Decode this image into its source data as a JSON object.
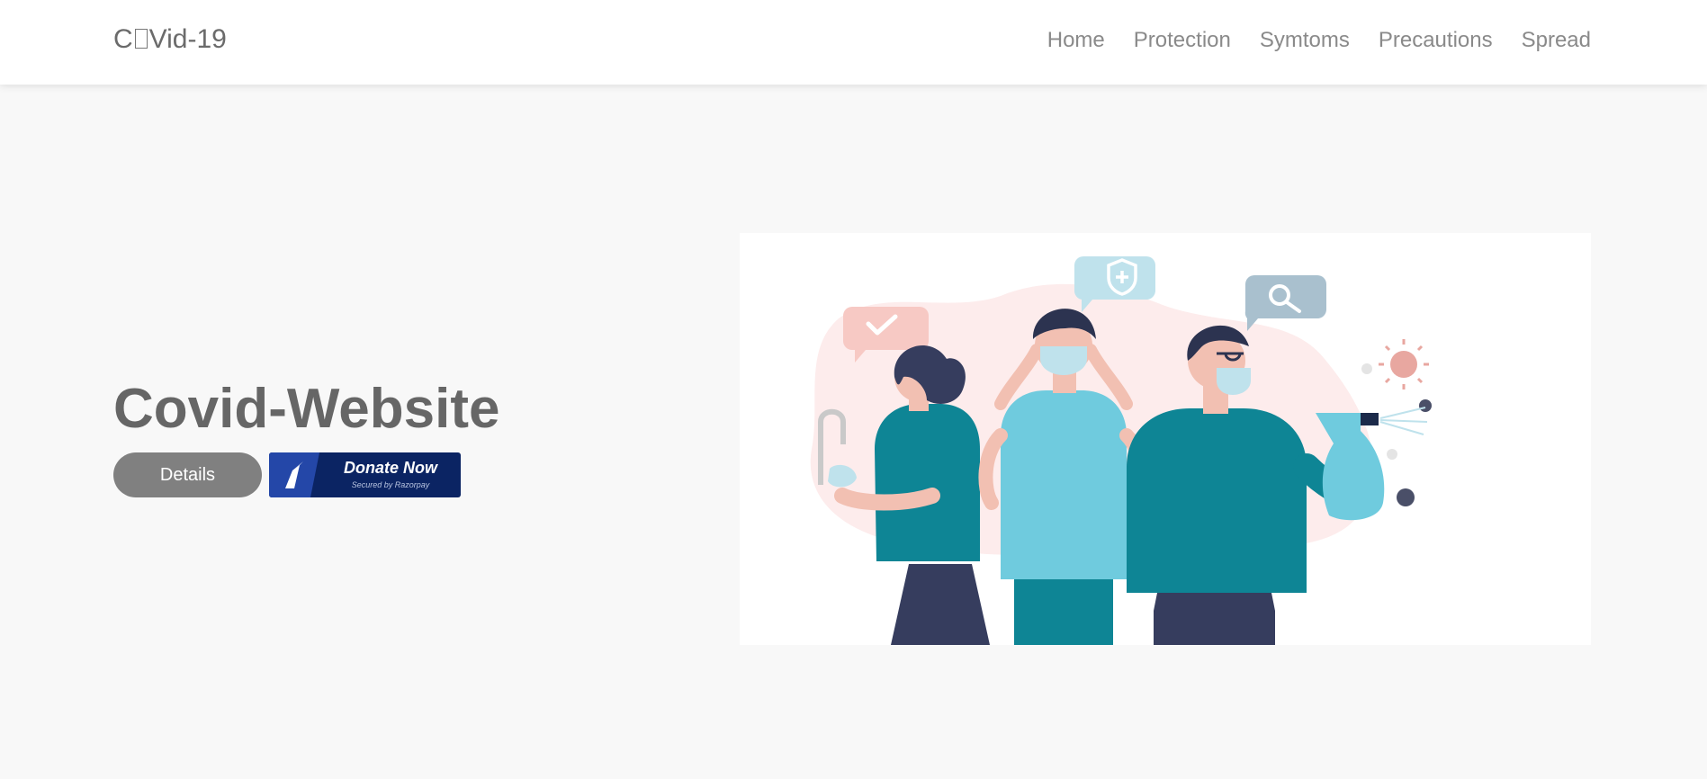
{
  "brand": {
    "prefix": "C",
    "suffix": "Vid-19"
  },
  "nav": {
    "home": "Home",
    "protection": "Protection",
    "symptoms": "Symtoms",
    "precautions": "Precautions",
    "spread": "Spread"
  },
  "hero": {
    "title": "Covid-Website",
    "details_label": "Details",
    "donate_label": "Donate Now",
    "donate_sublabel": "Secured by Razorpay"
  },
  "illustration": {
    "icon": "people-wearing-masks-illustration"
  },
  "colors": {
    "navbar_bg": "#ffffff",
    "page_bg": "#f8f8f8",
    "details_button": "#808080",
    "donate_button": "#0b2463",
    "teal": "#0e8595",
    "light_teal": "#6fcbde",
    "navy": "#363d5e"
  }
}
